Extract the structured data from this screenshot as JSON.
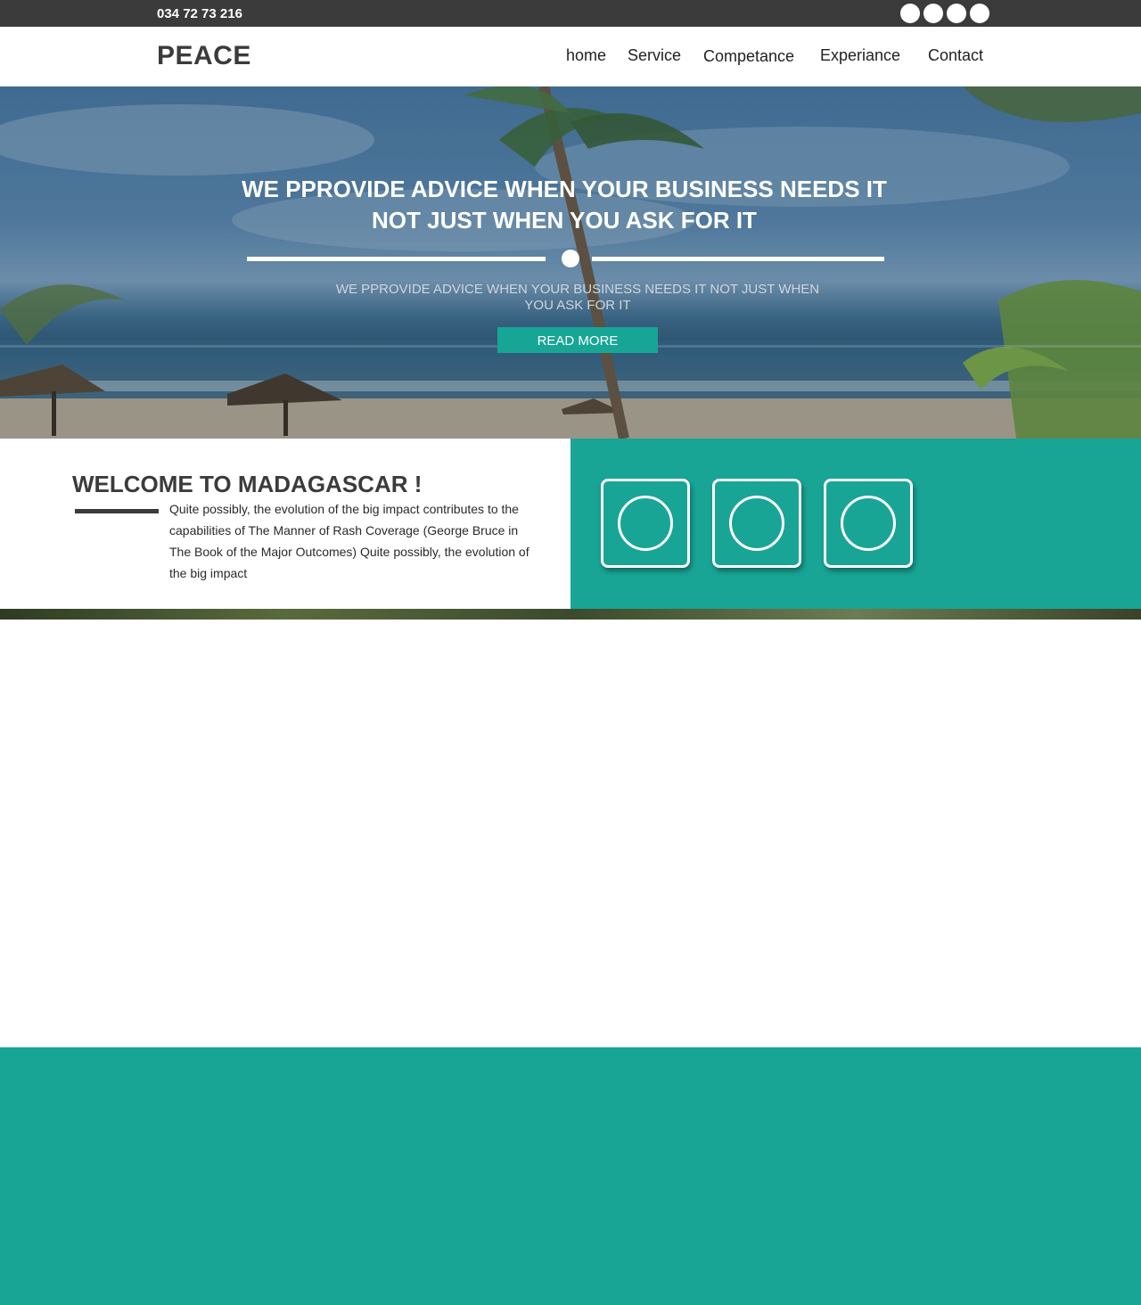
{
  "topbar": {
    "phone": "034 72 73 216",
    "social_icons": [
      "social-icon-1",
      "social-icon-2",
      "social-icon-3",
      "social-icon-4"
    ]
  },
  "header": {
    "logo": "PEACE",
    "nav": [
      "home",
      "Service",
      "Competance",
      "Experiance",
      "Contact"
    ]
  },
  "hero": {
    "title_line1": "WE PPROVIDE ADVICE WHEN YOUR BUSINESS NEEDS IT",
    "title_line2": "NOT JUST WHEN YOU ASK FOR IT",
    "subtitle": "WE PPROVIDE ADVICE WHEN YOUR BUSINESS NEEDS IT NOT JUST WHEN YOU ASK FOR IT",
    "button": "READ MORE"
  },
  "welcome": {
    "title": "WELCOME TO MADAGASCAR !",
    "text": "Quite possibly, the evolution of the big impact contributes to the capabilities of The Manner of Rash Coverage (George Bruce in The Book of the Major Outcomes) Quite possibly, the evolution of the big impact"
  },
  "features": {
    "icons": [
      "circle-icon",
      "circle-icon",
      "circle-icon"
    ]
  },
  "colors": {
    "accent": "#18a596",
    "dark": "#3b3b3b",
    "white": "#ffffff"
  }
}
